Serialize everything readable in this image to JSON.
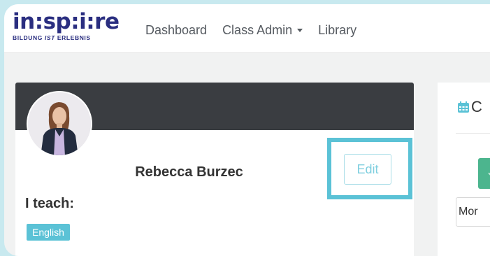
{
  "app": {
    "logo_main": "in:sp:i:re",
    "logo_sub_prefix": "BILDUNG ",
    "logo_sub_em": "IST",
    "logo_sub_suffix": " ERLEBNIS"
  },
  "nav": {
    "items": [
      {
        "label": "Dashboard"
      },
      {
        "label": "Class Admin",
        "has_dropdown": true
      },
      {
        "label": "Library"
      }
    ]
  },
  "profile": {
    "name": "Rebecca Burzec",
    "edit_label": "Edit",
    "teach_heading": "I teach:",
    "subjects": [
      "English"
    ]
  },
  "calendar_panel": {
    "title_partial": "C",
    "icon": "calendar-icon",
    "view_button_partial": "Mor"
  },
  "colors": {
    "background": "#c8e9ef",
    "brand": "#2a2e80",
    "accent": "#5bc2d6",
    "header_dark": "#3a3d41",
    "green": "#4cb58e"
  }
}
